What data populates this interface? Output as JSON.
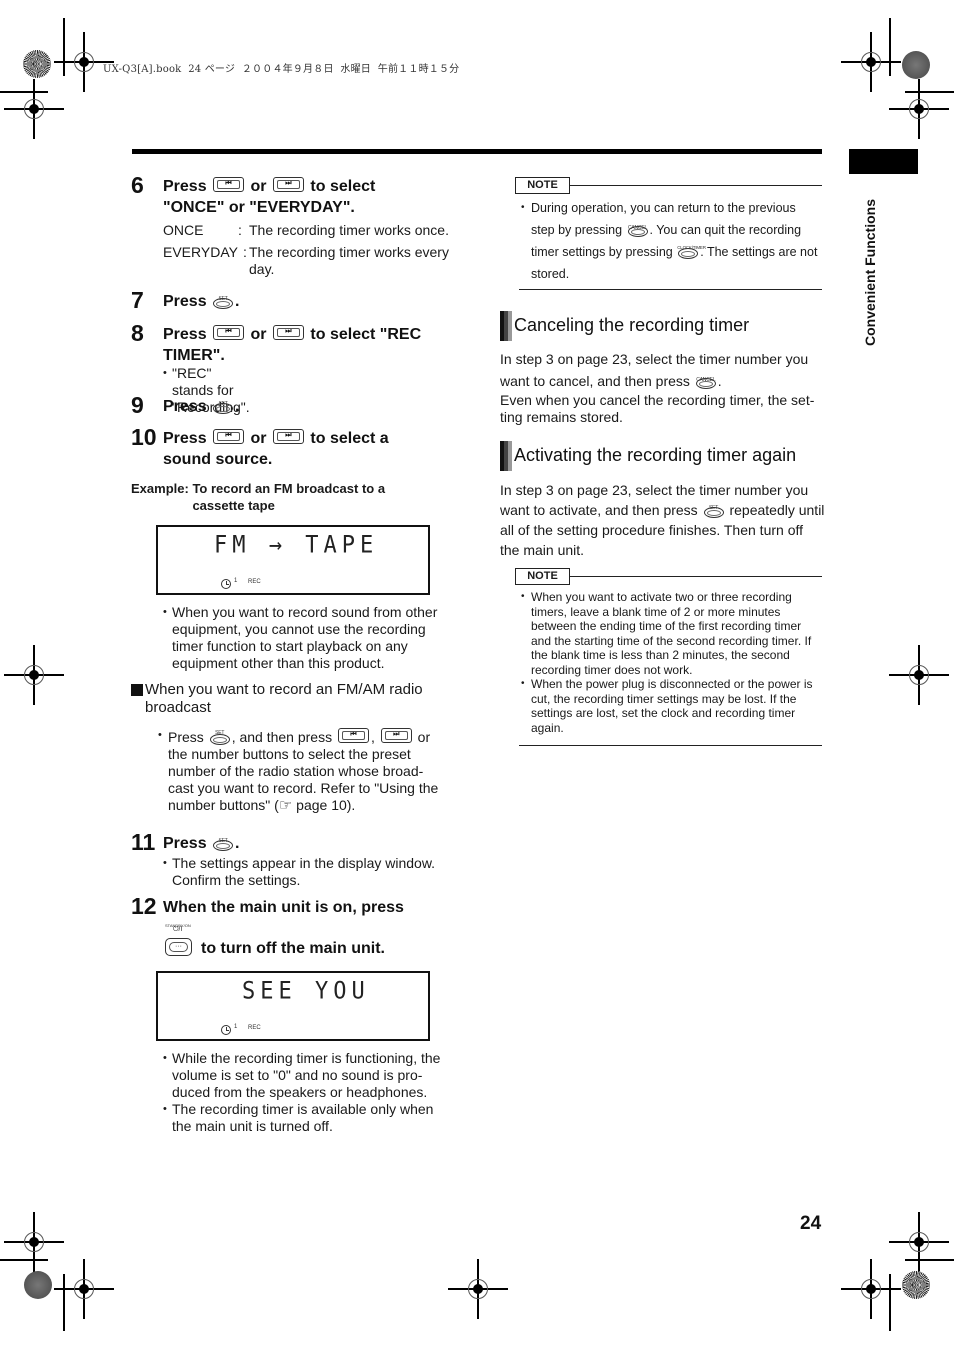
{
  "print_header": "UX-Q3[A].book  24 ページ  ２００４年９月８日  水曜日  午前１１時１５分",
  "side_tab": {
    "label": "Convenient Functions"
  },
  "page_number": "24",
  "buttons": {
    "prev_symbol": "⏮",
    "next_symbol": "⏭",
    "set_label": "SET",
    "cancel_label": "CANCEL",
    "clock_timer_label": "CLOCK/TIMER",
    "standby_label": "STANDBY/ON",
    "power_symbol": "⏻/I"
  },
  "steps": [
    {
      "number": "6",
      "text": {
        "press": "Press",
        "or": "or",
        "rest": "to select",
        "line2": "\"ONCE\" or \"EVERYDAY\"."
      },
      "definitions": [
        {
          "term": "ONCE",
          "sep": ":",
          "desc": "The recording timer works once."
        },
        {
          "term": "EVERYDAY",
          "sep": ":",
          "desc": "The recording timer works every day."
        }
      ]
    },
    {
      "number": "7",
      "text": {
        "press": "Press",
        "end": "."
      }
    },
    {
      "number": "8",
      "text": {
        "press": "Press",
        "or": "or",
        "rest": "to select \"REC",
        "line2": "TIMER\"."
      },
      "note": "\"REC\" stands for \"Recording\"."
    },
    {
      "number": "9",
      "text": {
        "press": "Press",
        "end": "."
      }
    },
    {
      "number": "10",
      "text": {
        "press": "Press",
        "or": "or",
        "rest": "to select a",
        "line2": "sound source."
      }
    },
    {
      "number": "11",
      "text": {
        "press": "Press",
        "end": "."
      },
      "notes": [
        "The settings appear in the display window. Confirm the settings."
      ]
    },
    {
      "number": "12",
      "text": {
        "line1": "When the main unit is on, press",
        "line2": "to turn off the main unit."
      }
    }
  ],
  "example": {
    "label": "Example:",
    "text": "To record an FM broadcast to a cassette tape",
    "display1": {
      "text": "FM  → TAPE",
      "timer_num": "1",
      "rec": "REC"
    },
    "display2": {
      "text": "SEE YOU",
      "timer_num": "1",
      "rec": "REC"
    }
  },
  "example_note": "When you want to record sound from other equipment, you cannot use the recording timer function to start playback on any equipment other than this product.",
  "fm_am": {
    "heading": "When you want to record an FM/AM radio broadcast",
    "bullet_press": "Press",
    "bullet_and_then": ", and then press",
    "bullet_comma": ",",
    "bullet_or": "or",
    "bullet_rest": "the number buttons to select the preset number of the radio station whose broad-cast you want to record. Refer to \"Using the number buttons\" (",
    "ref_icon": "☞",
    "bullet_page": "page 10)."
  },
  "after_display_notes": [
    "While the recording timer is functioning, the volume is set to \"0\" and no sound is pro-duced from the speakers or headphones.",
    "The recording timer is available only when the main unit is turned off."
  ],
  "note1": {
    "tag": "NOTE",
    "part1": "During operation, you can return to the previous step by pressing",
    "part2": ". You can quit the recording timer settings by pressing",
    "part3": ". The settings are not stored."
  },
  "section_cancel": {
    "title": "Canceling the recording timer",
    "para1_a": "In step 3 on page 23, select the timer number you want to cancel, and then press",
    "para1_b": ".",
    "para2": "Even when you cancel the recording timer, the set-ting remains stored."
  },
  "section_activate": {
    "title": "Activating the recording timer again",
    "para_a": "In step 3 on page 23, select the timer number you want to activate, and then press",
    "para_b": "repeatedly until all of the setting procedure finishes. Then turn off the main unit."
  },
  "note2": {
    "tag": "NOTE",
    "items": [
      "When you want to activate two or three recording timers, leave a blank time of 2 or more minutes between the ending time of the first recording timer and the starting time of the second recording timer. If the blank time is less than 2 minutes, the second recording timer does not work.",
      "When the power plug is disconnected or the power is cut, the recording timer settings may be lost. If the settings are lost, set the clock and recording timer again."
    ]
  }
}
